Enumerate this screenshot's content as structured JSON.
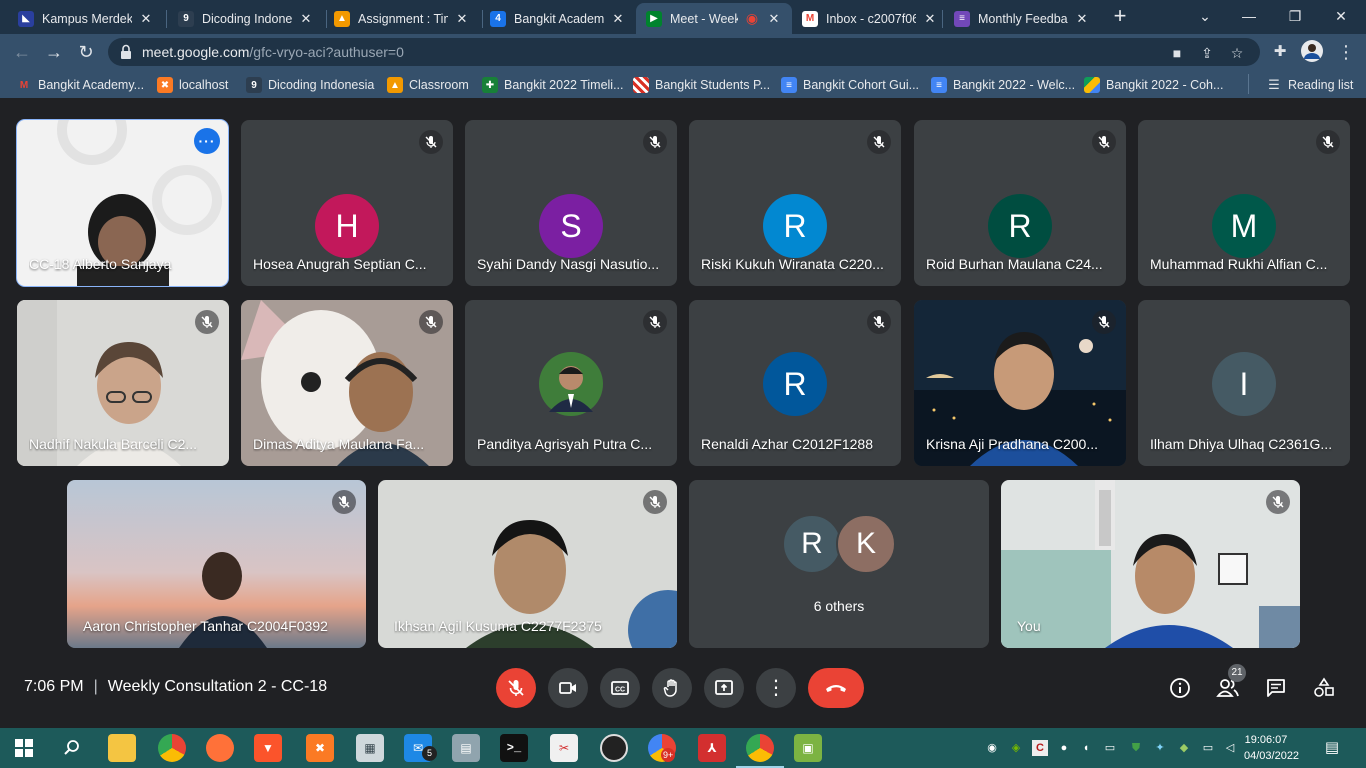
{
  "browser": {
    "tabs": [
      {
        "title": "Kampus Merdeka",
        "icon": "kampus-merdeka-icon"
      },
      {
        "title": "Dicoding Indonesia",
        "icon": "dicoding-icon"
      },
      {
        "title": "Assignment : Tim",
        "icon": "classroom-icon"
      },
      {
        "title": "Bangkit Academy",
        "icon": "bangkit-4-icon"
      },
      {
        "title": "Meet - Weekl",
        "icon": "meet-icon"
      },
      {
        "title": "Inbox - c2007f06",
        "icon": "gmail-icon"
      },
      {
        "title": "Monthly Feedback",
        "icon": "forms-icon"
      }
    ],
    "url_host": "meet.google.com",
    "url_path": "/gfc-vryo-aci?authuser=0",
    "bookmarks": [
      "Bangkit Academy...",
      "localhost",
      "Dicoding Indonesia",
      "Classroom",
      "Bangkit 2022 Timeli...",
      "Bangkit Students P...",
      "Bangkit Cohort Gui...",
      "Bangkit 2022 - Welc...",
      "Bangkit 2022 - Coh..."
    ],
    "reading_list": "Reading list"
  },
  "meet": {
    "tiles": [
      {
        "name": "CC-18 Alberto Sanjaya",
        "type": "video"
      },
      {
        "name": "Hosea Anugrah Septian C...",
        "initial": "H",
        "color": "#c2185b"
      },
      {
        "name": "Syahi Dandy Nasgi Nasutio...",
        "initial": "S",
        "color": "#7b1fa2"
      },
      {
        "name": "Riski Kukuh Wiranata C220...",
        "initial": "R",
        "color": "#0288d1"
      },
      {
        "name": "Roid Burhan Maulana C24...",
        "initial": "R",
        "color": "#004d40"
      },
      {
        "name": "Muhammad Rukhi Alfian C...",
        "initial": "M",
        "color": "#00584a"
      },
      {
        "name": "Nadhif Nakula Barceli C2...",
        "type": "video"
      },
      {
        "name": "Dimas Aditya Maulana Fa...",
        "type": "video"
      },
      {
        "name": "Panditya Agrisyah Putra C...",
        "type": "photo"
      },
      {
        "name": "Renaldi Azhar C2012F1288",
        "initial": "R",
        "color": "#01579b"
      },
      {
        "name": "Krisna Aji Pradhana C200...",
        "type": "video"
      },
      {
        "name": "Ilham Dhiya Ulhaq C2361G...",
        "initial": "I",
        "color": "#455a64"
      },
      {
        "name": "Aaron Christopher Tanhar C2004F0392",
        "type": "video"
      },
      {
        "name": "Ikhsan Agil Kusuma C2277F2375",
        "type": "video"
      },
      {
        "name": "You",
        "type": "video"
      }
    ],
    "others": {
      "label": "6 others",
      "initials": [
        "R",
        "K"
      ],
      "colors": [
        "#455a64",
        "#8d6e63"
      ]
    },
    "time": "7:06 PM",
    "meeting_title": "Weekly Consultation 2 - CC-18",
    "participants_count": "21"
  },
  "taskbar": {
    "mail_badge": "5",
    "chrome_badge": "9+",
    "time": "19:06:07",
    "date": "04/03/2022"
  }
}
